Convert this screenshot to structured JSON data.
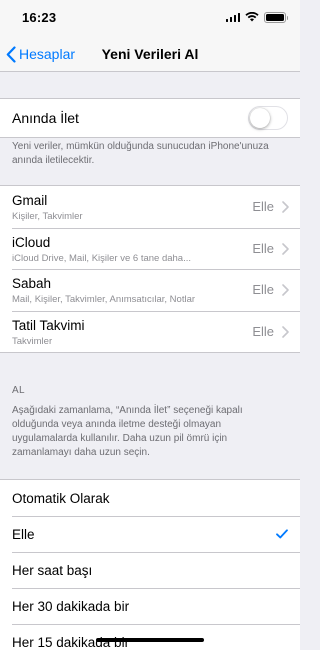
{
  "status_bar": {
    "time": "16:23"
  },
  "nav": {
    "back_label": "Hesaplar",
    "title": "Yeni Verileri Al"
  },
  "push": {
    "label": "Anında İlet",
    "enabled": false,
    "note": "Yeni veriler, mümkün olduğunda sunucudan iPhone'unuza anında iletilecektir."
  },
  "accounts": [
    {
      "name": "Gmail",
      "detail": "Kişiler, Takvimler",
      "value": "Elle"
    },
    {
      "name": "iCloud",
      "detail": "iCloud Drive, Mail, Kişiler ve 6 tane daha...",
      "value": "Elle"
    },
    {
      "name": "Sabah",
      "detail": "Mail, Kişiler, Takvimler, Anımsatıcılar, Notlar",
      "value": "Elle"
    },
    {
      "name": "Tatil Takvimi",
      "detail": "Takvimler",
      "value": "Elle"
    }
  ],
  "fetch": {
    "header": "AL",
    "note": "Aşağıdaki zamanlama, “Anında İlet” seçeneği kapalı olduğunda veya anında iletme desteği olmayan uygulamalarda kullanılır. Daha uzun pil ömrü için zamanlamayı daha uzun seçin.",
    "options": [
      {
        "label": "Otomatik Olarak",
        "selected": false
      },
      {
        "label": "Elle",
        "selected": true
      },
      {
        "label": "Her saat başı",
        "selected": false
      },
      {
        "label": "Her 30 dakikada bir",
        "selected": false
      },
      {
        "label": "Her 15 dakikada bir",
        "selected": false
      }
    ]
  },
  "colors": {
    "accent": "#007aff",
    "background": "#efeff4",
    "secondary_text": "#8e8e93"
  }
}
